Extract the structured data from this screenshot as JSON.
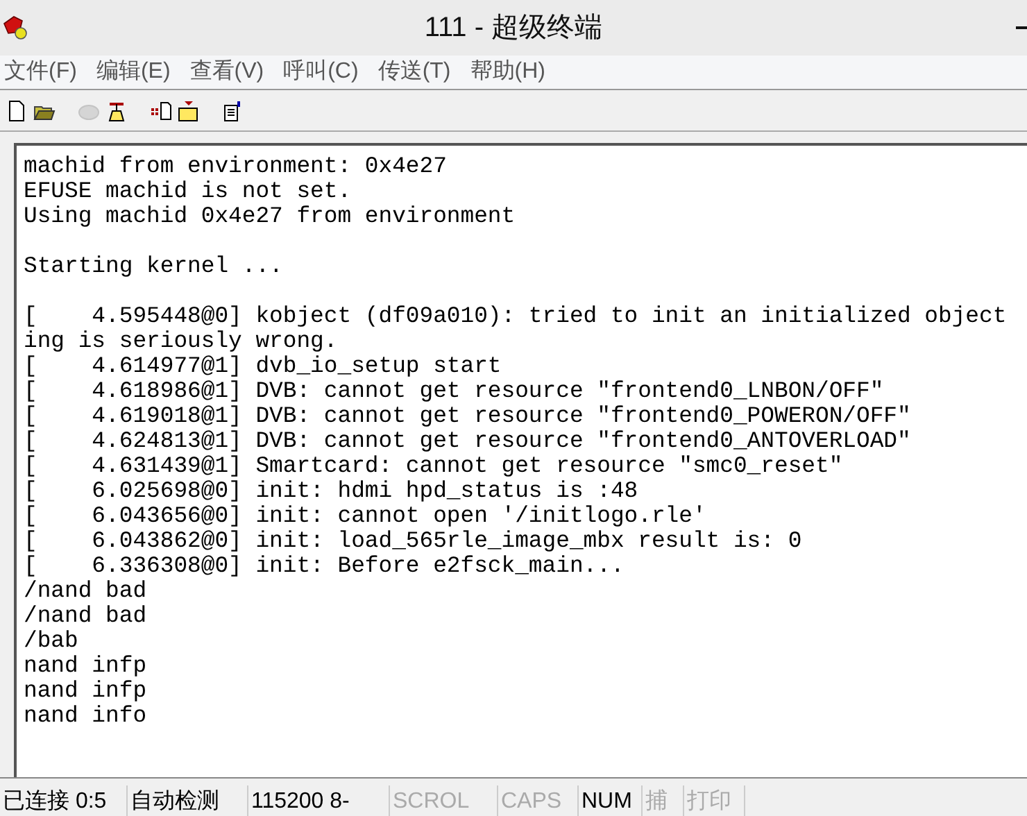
{
  "window": {
    "title": "111 - 超级终端"
  },
  "menu": [
    "文件(F)",
    "编辑(E)",
    "查看(V)",
    "呼叫(C)",
    "传送(T)",
    "帮助(H)"
  ],
  "toolbar": [
    {
      "kind": "new",
      "disabled": false
    },
    {
      "kind": "open",
      "disabled": false
    },
    {
      "kind": "sep"
    },
    {
      "kind": "call",
      "disabled": true
    },
    {
      "kind": "hangup",
      "disabled": false
    },
    {
      "kind": "sep"
    },
    {
      "kind": "send",
      "disabled": false
    },
    {
      "kind": "receive",
      "disabled": false
    },
    {
      "kind": "sep"
    },
    {
      "kind": "properties",
      "disabled": false
    }
  ],
  "terminal": {
    "blocks": [
      [
        "machid from environment: 0x4e27",
        "EFUSE machid is not set.",
        "Using machid 0x4e27 from environment"
      ],
      [
        "Starting kernel ..."
      ],
      [
        "[    4.595448@0] kobject (df09a010): tried to init an initialized object",
        "ing is seriously wrong.",
        "[    4.614977@1] dvb_io_setup start",
        "[    4.618986@1] DVB: cannot get resource \"frontend0_LNBON/OFF\"",
        "[    4.619018@1] DVB: cannot get resource \"frontend0_POWERON/OFF\"",
        "[    4.624813@1] DVB: cannot get resource \"frontend0_ANTOVERLOAD\"",
        "[    4.631439@1] Smartcard: cannot get resource \"smc0_reset\"",
        "[    6.025698@0] init: hdmi hpd_status is :48",
        "[    6.043656@0] init: cannot open '/initlogo.rle'",
        "[    6.043862@0] init: load_565rle_image_mbx result is: 0",
        "[    6.336308@0] init: Before e2fsck_main...",
        "/nand bad",
        "/nand bad",
        "/bab",
        "nand infp",
        "nand infp",
        "nand info"
      ]
    ]
  },
  "status_bar": [
    {
      "text": "已连接 0:5",
      "disabled": false
    },
    {
      "text": "自动检测",
      "disabled": false
    },
    {
      "text": "115200 8-",
      "disabled": false
    },
    {
      "text": "SCROL",
      "disabled": true
    },
    {
      "text": "CAPS",
      "disabled": true
    },
    {
      "text": "NUM",
      "disabled": false
    },
    {
      "text": "捕",
      "disabled": true
    },
    {
      "text": "打印",
      "disabled": true
    }
  ]
}
